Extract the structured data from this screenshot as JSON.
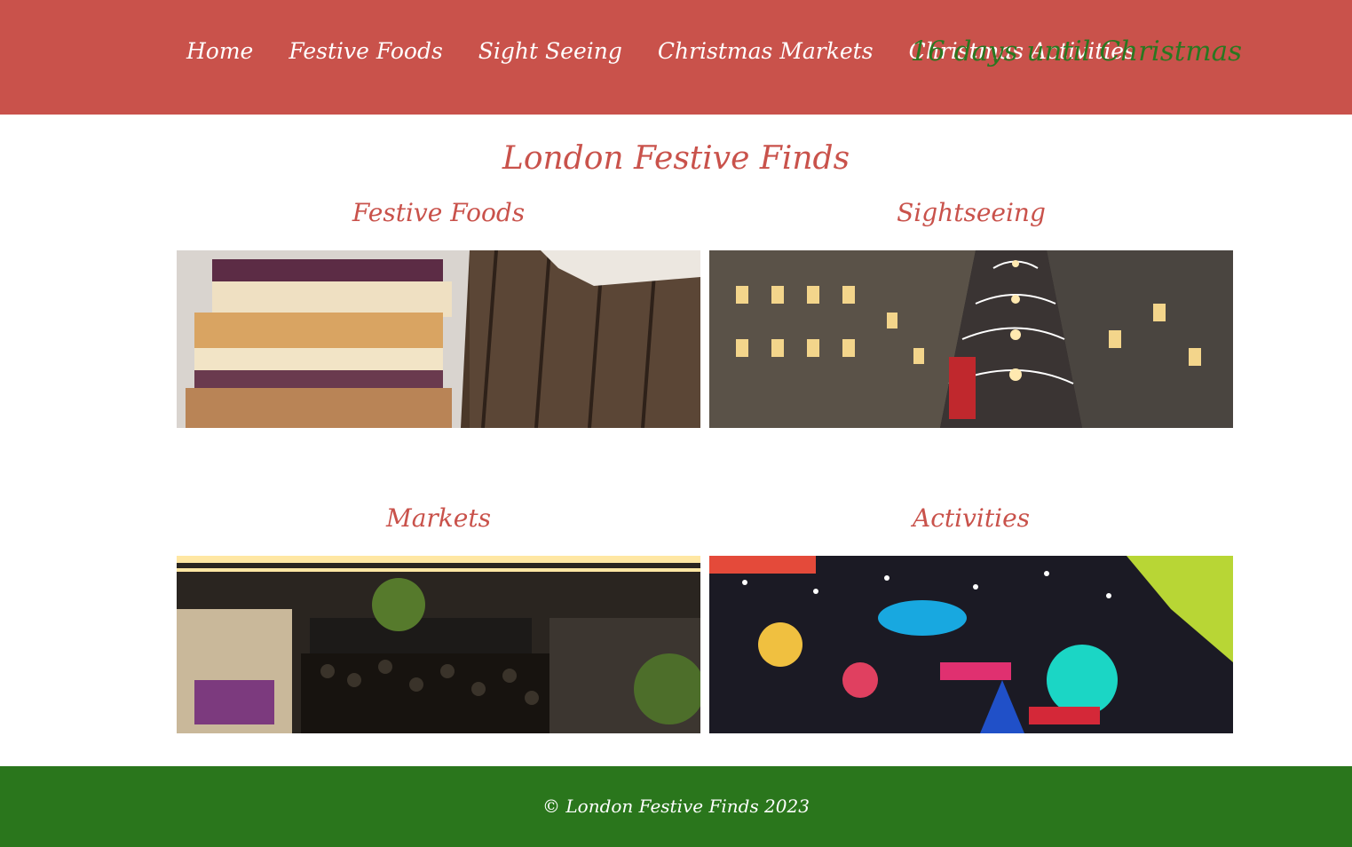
{
  "nav": {
    "links": [
      "Home",
      "Festive Foods",
      "Sight Seeing",
      "Christmas Markets",
      "Christmas Activities"
    ],
    "countdown": "16 days until Christmas"
  },
  "main": {
    "title": "London Festive Finds",
    "cards": [
      {
        "title": "Festive Foods",
        "image": "festive-food-sandwich"
      },
      {
        "title": "Sightseeing",
        "image": "regent-street-lights"
      },
      {
        "title": "Markets",
        "image": "christmas-market-stalls"
      },
      {
        "title": "Activities",
        "image": "winter-wonderland-fair"
      }
    ]
  },
  "footer": {
    "text": "© London Festive Finds 2023"
  },
  "colors": {
    "nav_bg": "#c9524b",
    "accent_red": "#c9524b",
    "accent_green": "#2a7720",
    "footer_bg": "#2a761c"
  }
}
